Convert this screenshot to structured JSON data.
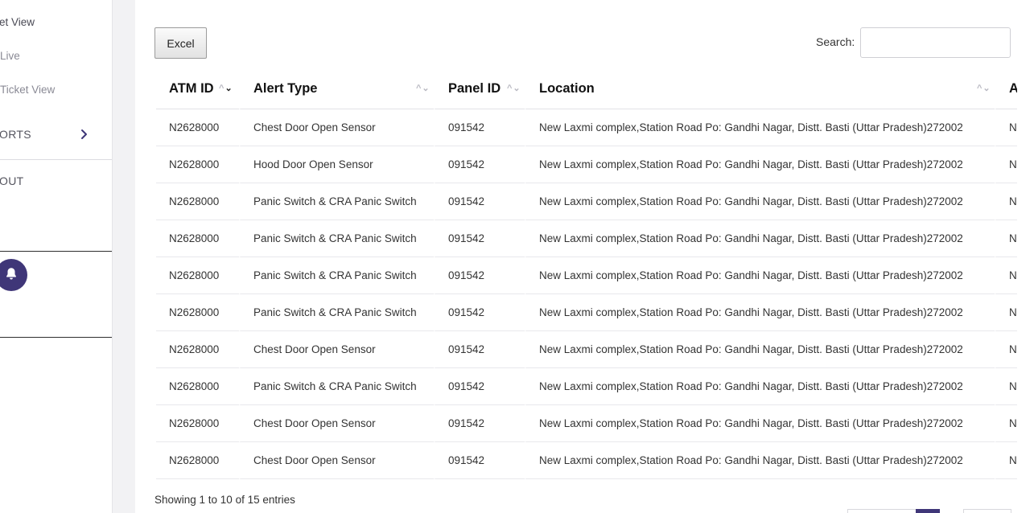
{
  "sidebar": {
    "items": [
      {
        "label": "et View"
      },
      {
        "label": " Live"
      },
      {
        "label": "Ticket View"
      },
      {
        "label": "ORTS"
      },
      {
        "label": "OUT"
      }
    ]
  },
  "toolbar": {
    "excel_label": "Excel",
    "search_label": "Search:",
    "search_value": "",
    "search_placeholder": ""
  },
  "table": {
    "columns": [
      "ATM ID",
      "Alert Type",
      "Panel ID",
      "Location",
      "A"
    ],
    "rows": [
      [
        "N2628000",
        "Chest Door Open Sensor",
        "091542",
        "New Laxmi complex,Station Road Po: Gandhi Nagar, Distt. Basti (Uttar Pradesh)272002",
        "N"
      ],
      [
        "N2628000",
        "Hood Door Open Sensor",
        "091542",
        "New Laxmi complex,Station Road Po: Gandhi Nagar, Distt. Basti (Uttar Pradesh)272002",
        "N"
      ],
      [
        "N2628000",
        "Panic Switch & CRA Panic Switch",
        "091542",
        "New Laxmi complex,Station Road Po: Gandhi Nagar, Distt. Basti (Uttar Pradesh)272002",
        "N"
      ],
      [
        "N2628000",
        "Panic Switch & CRA Panic Switch",
        "091542",
        "New Laxmi complex,Station Road Po: Gandhi Nagar, Distt. Basti (Uttar Pradesh)272002",
        "N"
      ],
      [
        "N2628000",
        "Panic Switch & CRA Panic Switch",
        "091542",
        "New Laxmi complex,Station Road Po: Gandhi Nagar, Distt. Basti (Uttar Pradesh)272002",
        "N"
      ],
      [
        "N2628000",
        "Panic Switch & CRA Panic Switch",
        "091542",
        "New Laxmi complex,Station Road Po: Gandhi Nagar, Distt. Basti (Uttar Pradesh)272002",
        "N"
      ],
      [
        "N2628000",
        "Chest Door Open Sensor",
        "091542",
        "New Laxmi complex,Station Road Po: Gandhi Nagar, Distt. Basti (Uttar Pradesh)272002",
        "N"
      ],
      [
        "N2628000",
        "Panic Switch & CRA Panic Switch",
        "091542",
        "New Laxmi complex,Station Road Po: Gandhi Nagar, Distt. Basti (Uttar Pradesh)272002",
        "N"
      ],
      [
        "N2628000",
        "Chest Door Open Sensor",
        "091542",
        "New Laxmi complex,Station Road Po: Gandhi Nagar, Distt. Basti (Uttar Pradesh)272002",
        "N"
      ],
      [
        "N2628000",
        "Chest Door Open Sensor",
        "091542",
        "New Laxmi complex,Station Road Po: Gandhi Nagar, Distt. Basti (Uttar Pradesh)272002",
        "N"
      ]
    ]
  },
  "footer": {
    "info": "Showing 1 to 10 of 15 entries"
  },
  "colors": {
    "accent": "#3f3678"
  },
  "icons": {
    "sidebar_chevron": "chevron-right-icon",
    "notification": "bell-icon",
    "sort": "sort-arrows-icon"
  }
}
